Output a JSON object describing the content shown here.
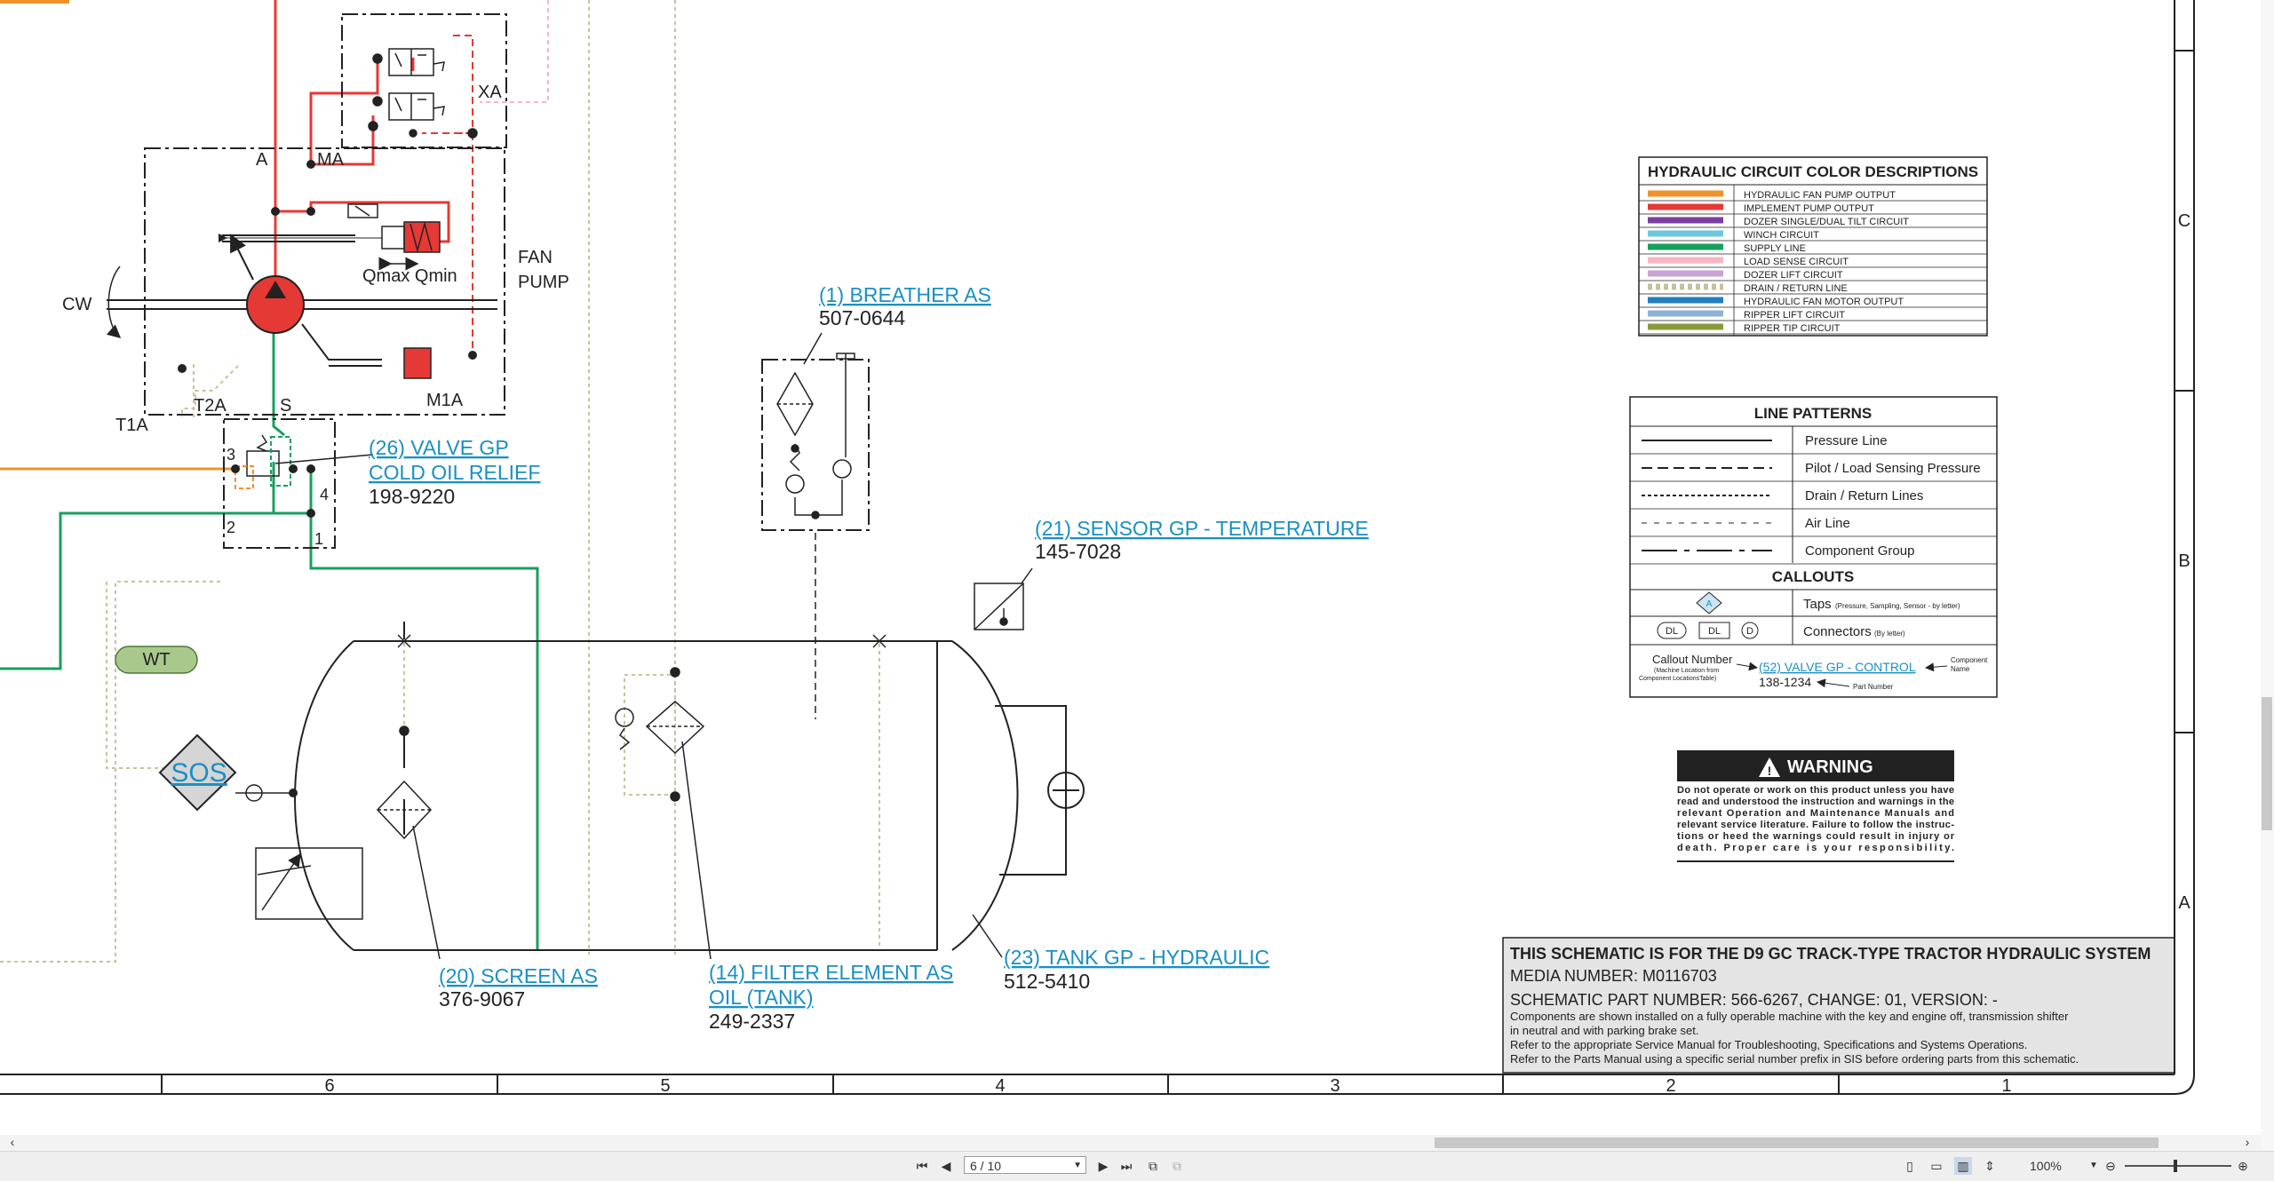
{
  "callouts": {
    "breather": {
      "label": "(1) BREATHER AS",
      "part": "507-0644"
    },
    "valve_relief": {
      "label1": "(26) VALVE GP",
      "label2": "COLD OIL RELIEF",
      "part": "198-9220"
    },
    "sensor_temp": {
      "label": "(21) SENSOR GP - TEMPERATURE",
      "part": "145-7028"
    },
    "screen": {
      "label": "(20) SCREEN AS",
      "part": "376-9067"
    },
    "filter": {
      "label1": "(14) FILTER ELEMENT AS",
      "label2": "OIL (TANK)",
      "part": "249-2337"
    },
    "tank": {
      "label": "(23) TANK GP - HYDRAULIC",
      "part": "512-5410"
    }
  },
  "diagram_labels": {
    "xa": "XA",
    "a": "A",
    "ma": "MA",
    "qmax_qmin": "Qmax Qmin",
    "fan_pump_1": "FAN",
    "fan_pump_2": "PUMP",
    "cw": "CW",
    "t2a": "T2A",
    "s": "S",
    "m1a": "M1A",
    "t1a": "T1A",
    "port3": "3",
    "port4": "4",
    "port2": "2",
    "port1": "1",
    "wt": "WT",
    "sos": "SOS"
  },
  "color_legend": {
    "title": "HYDRAULIC CIRCUIT COLOR DESCRIPTIONS",
    "items": [
      {
        "label": "HYDRAULIC FAN PUMP OUTPUT",
        "color": "#f0922b"
      },
      {
        "label": "IMPLEMENT PUMP OUTPUT",
        "color": "#e53935"
      },
      {
        "label": "DOZER SINGLE/DUAL TILT CIRCUIT",
        "color": "#7b3fa0"
      },
      {
        "label": "WINCH CIRCUIT",
        "color": "#6cc7dd"
      },
      {
        "label": "SUPPLY LINE",
        "color": "#17a05d"
      },
      {
        "label": "LOAD SENSE CIRCUIT",
        "color": "#f7b6c2"
      },
      {
        "label": "DOZER LIFT CIRCUIT",
        "color": "#c9a3d3"
      },
      {
        "label": "DRAIN / RETURN LINE",
        "color": "#c6c39a"
      },
      {
        "label": "HYDRAULIC FAN MOTOR OUTPUT",
        "color": "#1f7fbf"
      },
      {
        "label": "RIPPER LIFT CIRCUIT",
        "color": "#8fb1d6"
      },
      {
        "label": "RIPPER TIP CIRCUIT",
        "color": "#8a9a3a"
      }
    ]
  },
  "line_patterns": {
    "title": "LINE PATTERNS",
    "items": [
      {
        "label": "Pressure Line"
      },
      {
        "label": "Pilot / Load Sensing Pressure"
      },
      {
        "label": "Drain / Return Lines"
      },
      {
        "label": "Air Line"
      },
      {
        "label": "Component Group"
      }
    ],
    "callouts_title": "CALLOUTS",
    "taps_label": "Taps",
    "taps_note": "(Pressure, Sampling, Sensor - by letter)",
    "connectors_label": "Connectors",
    "connectors_note": "(By letter)",
    "conn_dl1": "DL",
    "conn_dl2": "DL",
    "conn_d": "D",
    "tap_letter": "A",
    "callout_number": "Callout Number",
    "callout_number_note1": "(Machine Location from",
    "callout_number_note2": "Component LocationsTable)",
    "example_link": "(52) VALVE GP - CONTROL",
    "example_part": "138-1234",
    "component_name1": "Component",
    "component_name2": "Name",
    "part_number": "Part Number"
  },
  "warning": {
    "title": "WARNING",
    "lines": [
      "Do not operate or work on this product unless you have",
      "read and understood the instruction and warnings in the",
      "relevant Operation and Maintenance Manuals and",
      "relevant service literature. Failure to follow the instruc-",
      "tions or heed the warnings could result in injury or",
      "death. Proper care is your responsibility."
    ]
  },
  "title_block": {
    "title": "THIS SCHEMATIC IS FOR THE D9 GC TRACK-TYPE TRACTOR HYDRAULIC SYSTEM",
    "media": "MEDIA NUMBER: M0116703",
    "part": "SCHEMATIC PART NUMBER: 566-6267, CHANGE: 01, VERSION: -",
    "notes": [
      "Components are shown installed on a fully operable machine with the key and engine off, transmission shifter",
      "in neutral and with parking brake set.",
      "Refer to the appropriate Service Manual for Troubleshooting, Specifications and Systems Operations.",
      "Refer to the Parts Manual using a specific serial number prefix in SIS before ordering parts from this schematic."
    ]
  },
  "grid": {
    "columns": [
      "6",
      "5",
      "4",
      "3",
      "2",
      "1"
    ],
    "rows": [
      "C",
      "B",
      "A"
    ]
  },
  "toolbar": {
    "page": "6 / 10",
    "zoom": "100%"
  }
}
